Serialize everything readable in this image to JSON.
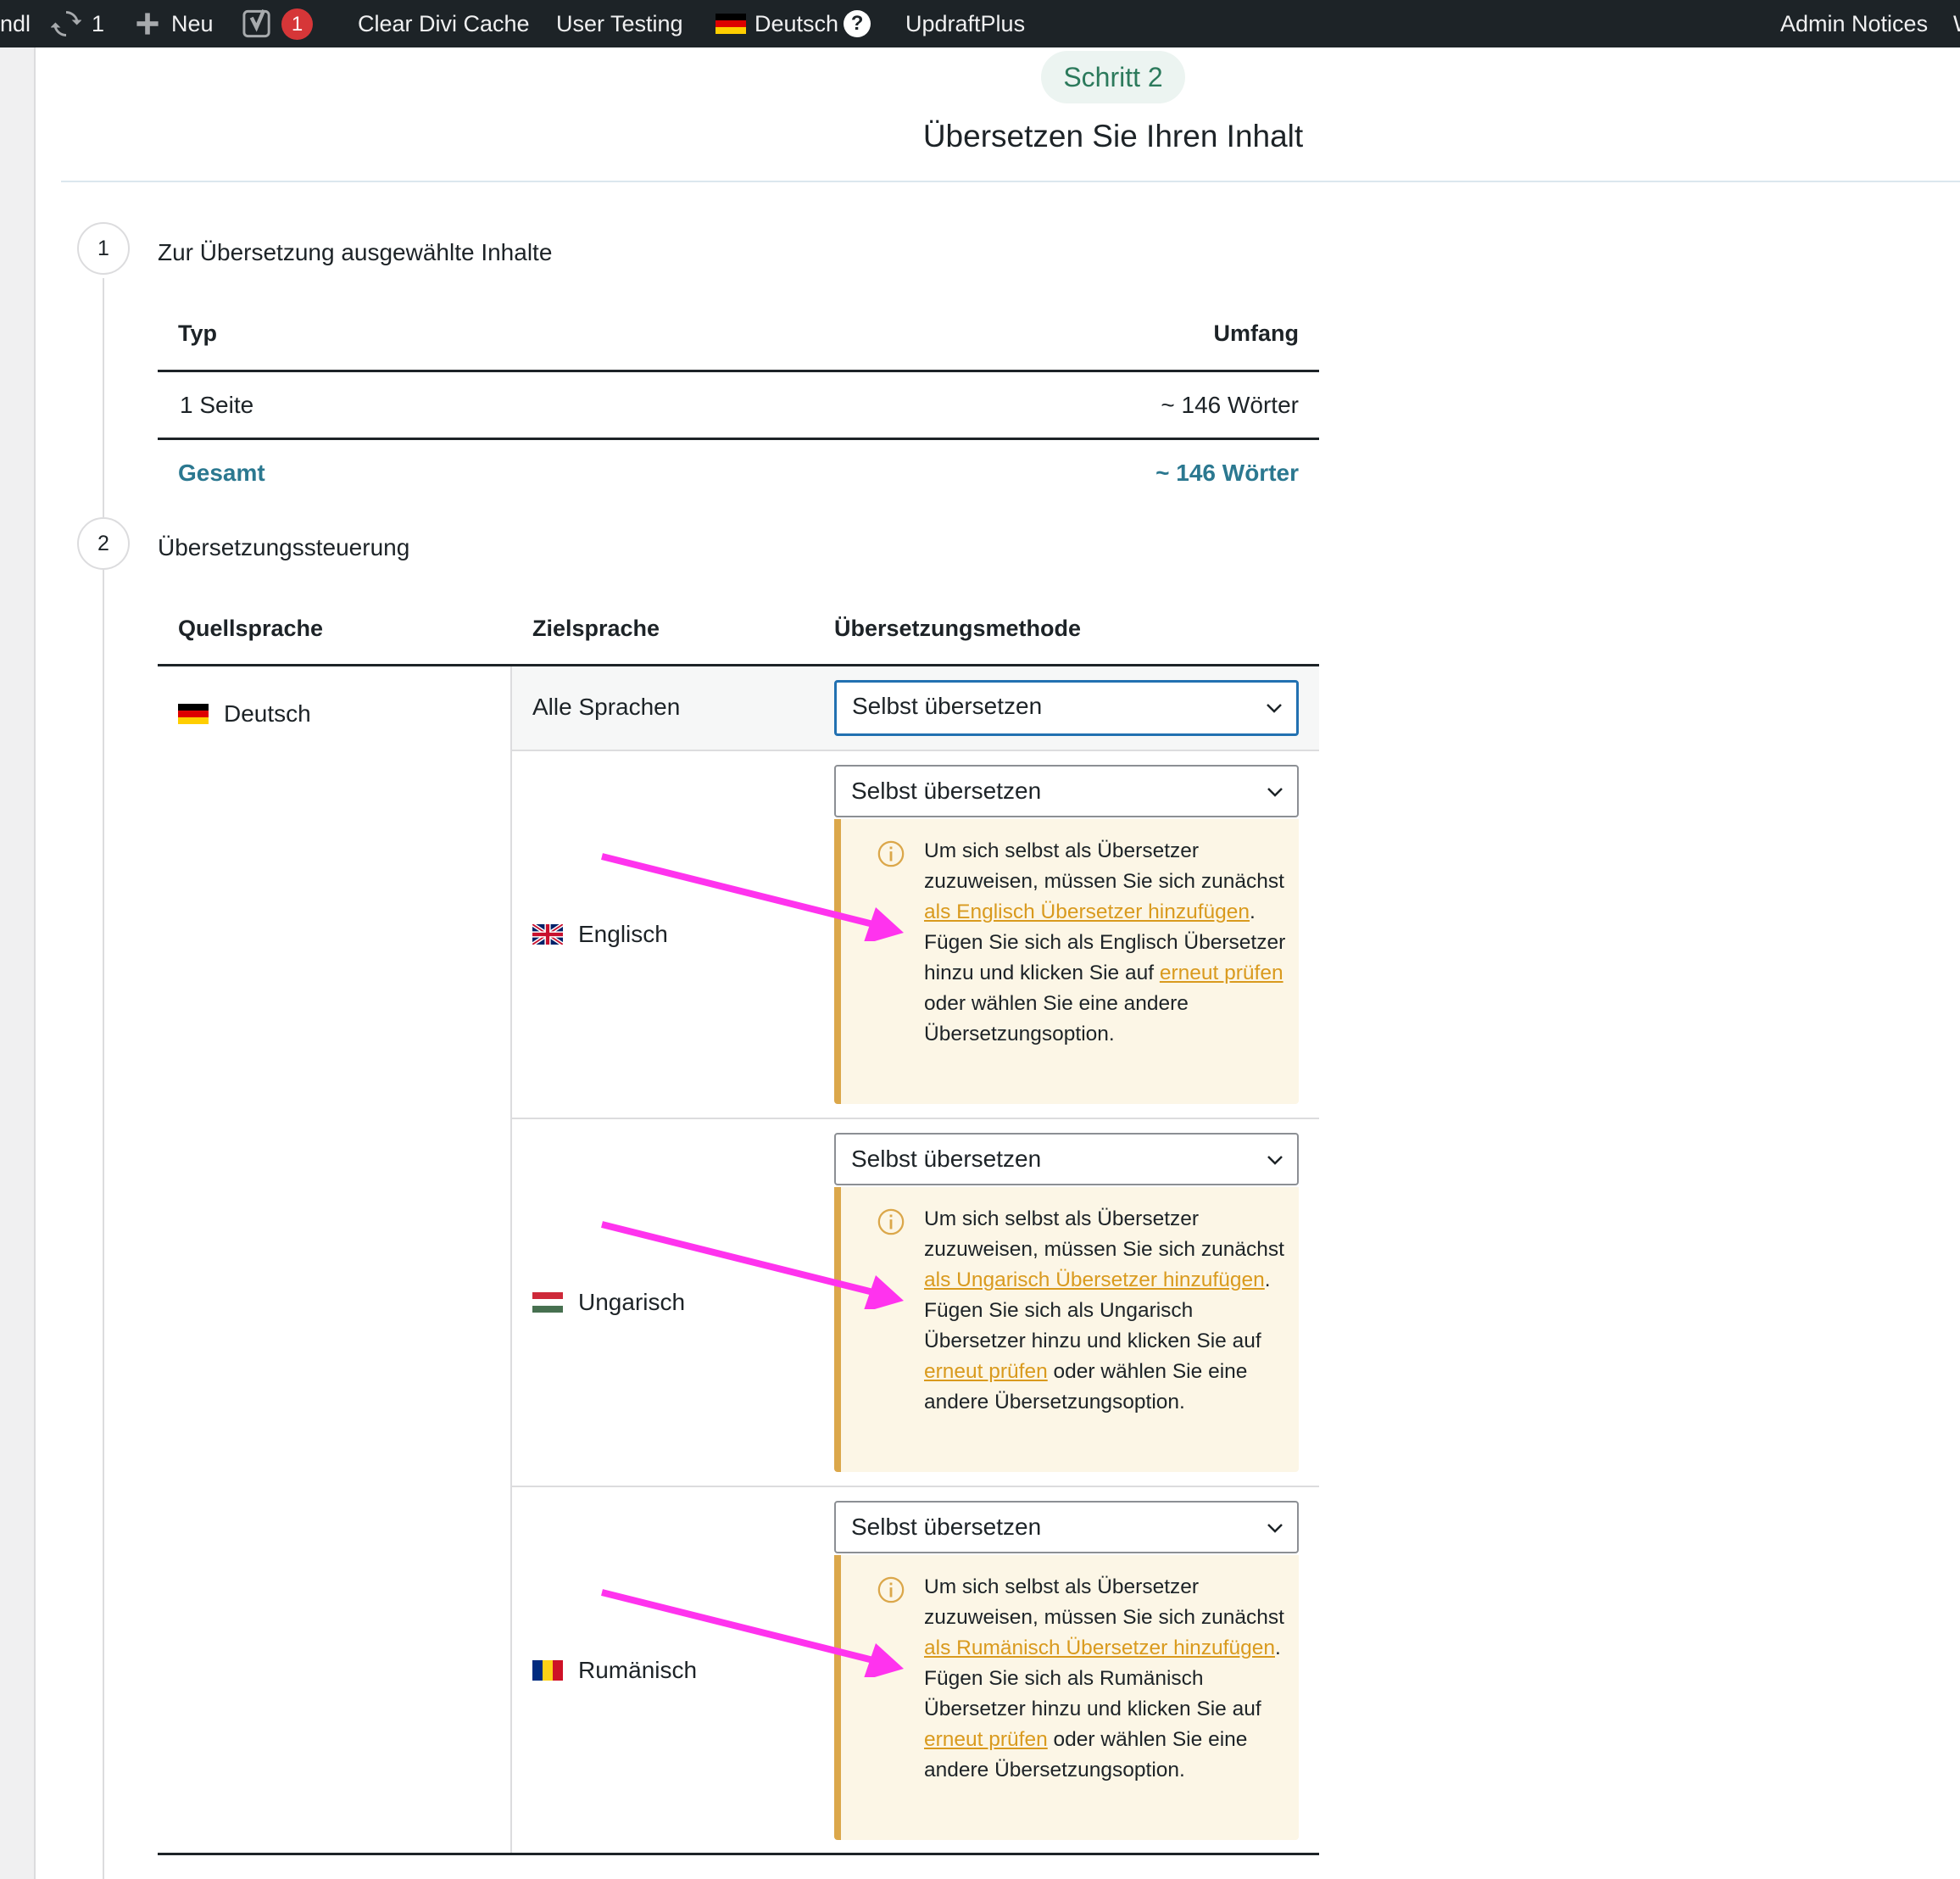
{
  "admin_bar": {
    "site_fragment": "ndl",
    "updates_count": "1",
    "new_label": "Neu",
    "seo_badge": "1",
    "clear_cache": "Clear Divi Cache",
    "user_testing": "User Testing",
    "language": "Deutsch",
    "help": "?",
    "updraft": "UpdraftPlus",
    "admin_notices": "Admin Notices",
    "overflow": "W"
  },
  "header": {
    "step_pill": "Schritt 2",
    "title": "Übersetzen Sie Ihren Inhalt"
  },
  "section1": {
    "number": "1",
    "title": "Zur Übersetzung ausgewählte Inhalte",
    "col_type": "Typ",
    "col_scope": "Umfang",
    "rows": [
      {
        "type": "1 Seite",
        "scope": "~ 146 Wörter"
      }
    ],
    "total_label": "Gesamt",
    "total_value": "~ 146 Wörter"
  },
  "section2": {
    "number": "2",
    "title": "Übersetzungssteuerung",
    "col_source": "Quellsprache",
    "col_target": "Zielsprache",
    "col_method": "Übersetzungsmethode",
    "source_language": "Deutsch",
    "all_languages": "Alle Sprachen",
    "all_method": "Selbst übersetzen",
    "languages": [
      {
        "name": "Englisch",
        "method": "Selbst übersetzen",
        "notice": {
          "p1": "Um sich selbst als Übersetzer zuzuweisen, müssen Sie sich zunächst ",
          "link1": "als Englisch Übersetzer hinzufügen",
          "p2": ".",
          "p3": "Fügen Sie sich als Englisch Übersetzer hinzu und klicken Sie auf ",
          "link2": "erneut prüfen",
          "p4": " oder wählen Sie eine andere Übersetzungsoption."
        }
      },
      {
        "name": "Ungarisch",
        "method": "Selbst übersetzen",
        "notice": {
          "p1": "Um sich selbst als Übersetzer zuzuweisen, müssen Sie sich zunächst ",
          "link1": "als Ungarisch Übersetzer hinzufügen",
          "p2": ".",
          "p3": "Fügen Sie sich als Ungarisch Übersetzer hinzu und klicken Sie auf ",
          "link2": "erneut prüfen",
          "p4": " oder wählen Sie eine andere Übersetzungsoption."
        }
      },
      {
        "name": "Rumänisch",
        "method": "Selbst übersetzen",
        "notice": {
          "p1": "Um sich selbst als Übersetzer zuzuweisen, müssen Sie sich zunächst ",
          "link1": "als Rumänisch Übersetzer hinzufügen",
          "p2": ".",
          "p3": "Fügen Sie sich als Rumänisch Übersetzer hinzu und klicken Sie auf ",
          "link2": "erneut prüfen",
          "p4": " oder wählen Sie eine andere Übersetzungsoption."
        }
      }
    ]
  },
  "colors": {
    "admin_bar_bg": "#1d2327",
    "accent_teal": "#2b7890",
    "step_green": "#2c7a5c",
    "notice_bg": "#fcf6e6",
    "notice_border": "#dba74a",
    "link_orange": "#d99a1e",
    "annotation_arrow": "#ff33ee",
    "badge_red": "#d63638"
  },
  "icons": {
    "updates": "refresh-icon",
    "new": "plus-icon",
    "seo": "yoast-icon",
    "flag_de": "germany-flag-icon",
    "flag_en": "uk-flag-icon",
    "flag_hu": "hungary-flag-icon",
    "flag_ro": "romania-flag-icon",
    "dropdown": "chevron-down-icon",
    "notice": "info-icon",
    "annotation": "arrow-icon"
  }
}
